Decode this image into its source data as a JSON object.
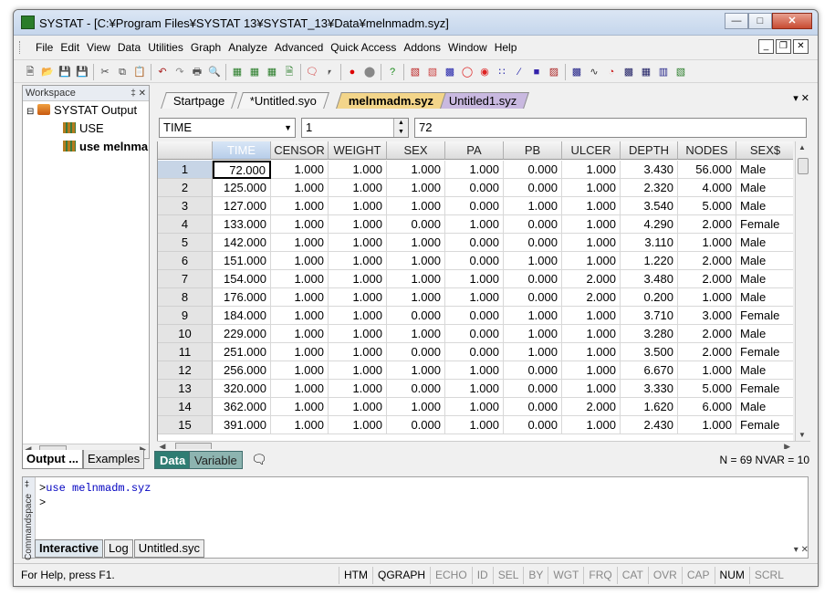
{
  "window": {
    "title": "SYSTAT - [C:¥Program Files¥SYSTAT 13¥SYSTAT_13¥Data¥melnmadm.syz]"
  },
  "menus": [
    "File",
    "Edit",
    "View",
    "Data",
    "Utilities",
    "Graph",
    "Analyze",
    "Advanced",
    "Quick Access",
    "Addons",
    "Window",
    "Help"
  ],
  "workspace": {
    "title": "Workspace",
    "tree_root": "SYSTAT Output",
    "tree_items": [
      "USE",
      "use melnma"
    ],
    "tabs": [
      "Output ...",
      "Examples"
    ]
  },
  "doc_tabs": [
    "Startpage",
    "*Untitled.syo",
    "melnmadm.syz",
    "Untitled1.syz"
  ],
  "cell_bar": {
    "variable": "TIME",
    "row": "1",
    "value": "72"
  },
  "grid": {
    "columns": [
      "TIME",
      "CENSOR",
      "WEIGHT",
      "SEX",
      "PA",
      "PB",
      "ULCER",
      "DEPTH",
      "NODES",
      "SEX$"
    ],
    "rows": [
      [
        "1",
        "72.000",
        "1.000",
        "1.000",
        "1.000",
        "1.000",
        "0.000",
        "1.000",
        "3.430",
        "56.000",
        "Male"
      ],
      [
        "2",
        "125.000",
        "1.000",
        "1.000",
        "1.000",
        "0.000",
        "0.000",
        "1.000",
        "2.320",
        "4.000",
        "Male"
      ],
      [
        "3",
        "127.000",
        "1.000",
        "1.000",
        "1.000",
        "0.000",
        "1.000",
        "1.000",
        "3.540",
        "5.000",
        "Male"
      ],
      [
        "4",
        "133.000",
        "1.000",
        "1.000",
        "0.000",
        "1.000",
        "0.000",
        "1.000",
        "4.290",
        "2.000",
        "Female"
      ],
      [
        "5",
        "142.000",
        "1.000",
        "1.000",
        "1.000",
        "0.000",
        "0.000",
        "1.000",
        "3.110",
        "1.000",
        "Male"
      ],
      [
        "6",
        "151.000",
        "1.000",
        "1.000",
        "1.000",
        "0.000",
        "1.000",
        "1.000",
        "1.220",
        "2.000",
        "Male"
      ],
      [
        "7",
        "154.000",
        "1.000",
        "1.000",
        "1.000",
        "1.000",
        "0.000",
        "2.000",
        "3.480",
        "2.000",
        "Male"
      ],
      [
        "8",
        "176.000",
        "1.000",
        "1.000",
        "1.000",
        "1.000",
        "0.000",
        "2.000",
        "0.200",
        "1.000",
        "Male"
      ],
      [
        "9",
        "184.000",
        "1.000",
        "1.000",
        "0.000",
        "0.000",
        "1.000",
        "1.000",
        "3.710",
        "3.000",
        "Female"
      ],
      [
        "10",
        "229.000",
        "1.000",
        "1.000",
        "1.000",
        "0.000",
        "1.000",
        "1.000",
        "3.280",
        "2.000",
        "Male"
      ],
      [
        "11",
        "251.000",
        "1.000",
        "1.000",
        "0.000",
        "0.000",
        "1.000",
        "1.000",
        "3.500",
        "2.000",
        "Female"
      ],
      [
        "12",
        "256.000",
        "1.000",
        "1.000",
        "1.000",
        "1.000",
        "0.000",
        "1.000",
        "6.670",
        "1.000",
        "Male"
      ],
      [
        "13",
        "320.000",
        "1.000",
        "1.000",
        "0.000",
        "1.000",
        "0.000",
        "1.000",
        "3.330",
        "5.000",
        "Female"
      ],
      [
        "14",
        "362.000",
        "1.000",
        "1.000",
        "1.000",
        "1.000",
        "0.000",
        "2.000",
        "1.620",
        "6.000",
        "Male"
      ],
      [
        "15",
        "391.000",
        "1.000",
        "1.000",
        "0.000",
        "1.000",
        "0.000",
        "1.000",
        "2.430",
        "1.000",
        "Female"
      ]
    ]
  },
  "data_tabs": [
    "Data",
    "Variable"
  ],
  "stats": "N = 69  NVAR = 10",
  "commandspace": {
    "label": "Commandspace",
    "prompt": ">",
    "command": "use melnmadm.syz",
    "prompt2": ">",
    "tabs": [
      "Interactive",
      "Log",
      "Untitled.syc"
    ]
  },
  "status": {
    "message": "For Help, press F1.",
    "indicators": [
      "HTM",
      "QGRAPH",
      "ECHO",
      "ID",
      "SEL",
      "BY",
      "WGT",
      "FRQ",
      "CAT",
      "OVR",
      "CAP",
      "NUM",
      "SCRL"
    ],
    "active_indicators": [
      "HTM",
      "QGRAPH",
      "NUM"
    ]
  },
  "colors": {
    "active_tab": "#f3d58a",
    "data_tab": "#2f7d73",
    "selected_header": "#b7cde9"
  }
}
